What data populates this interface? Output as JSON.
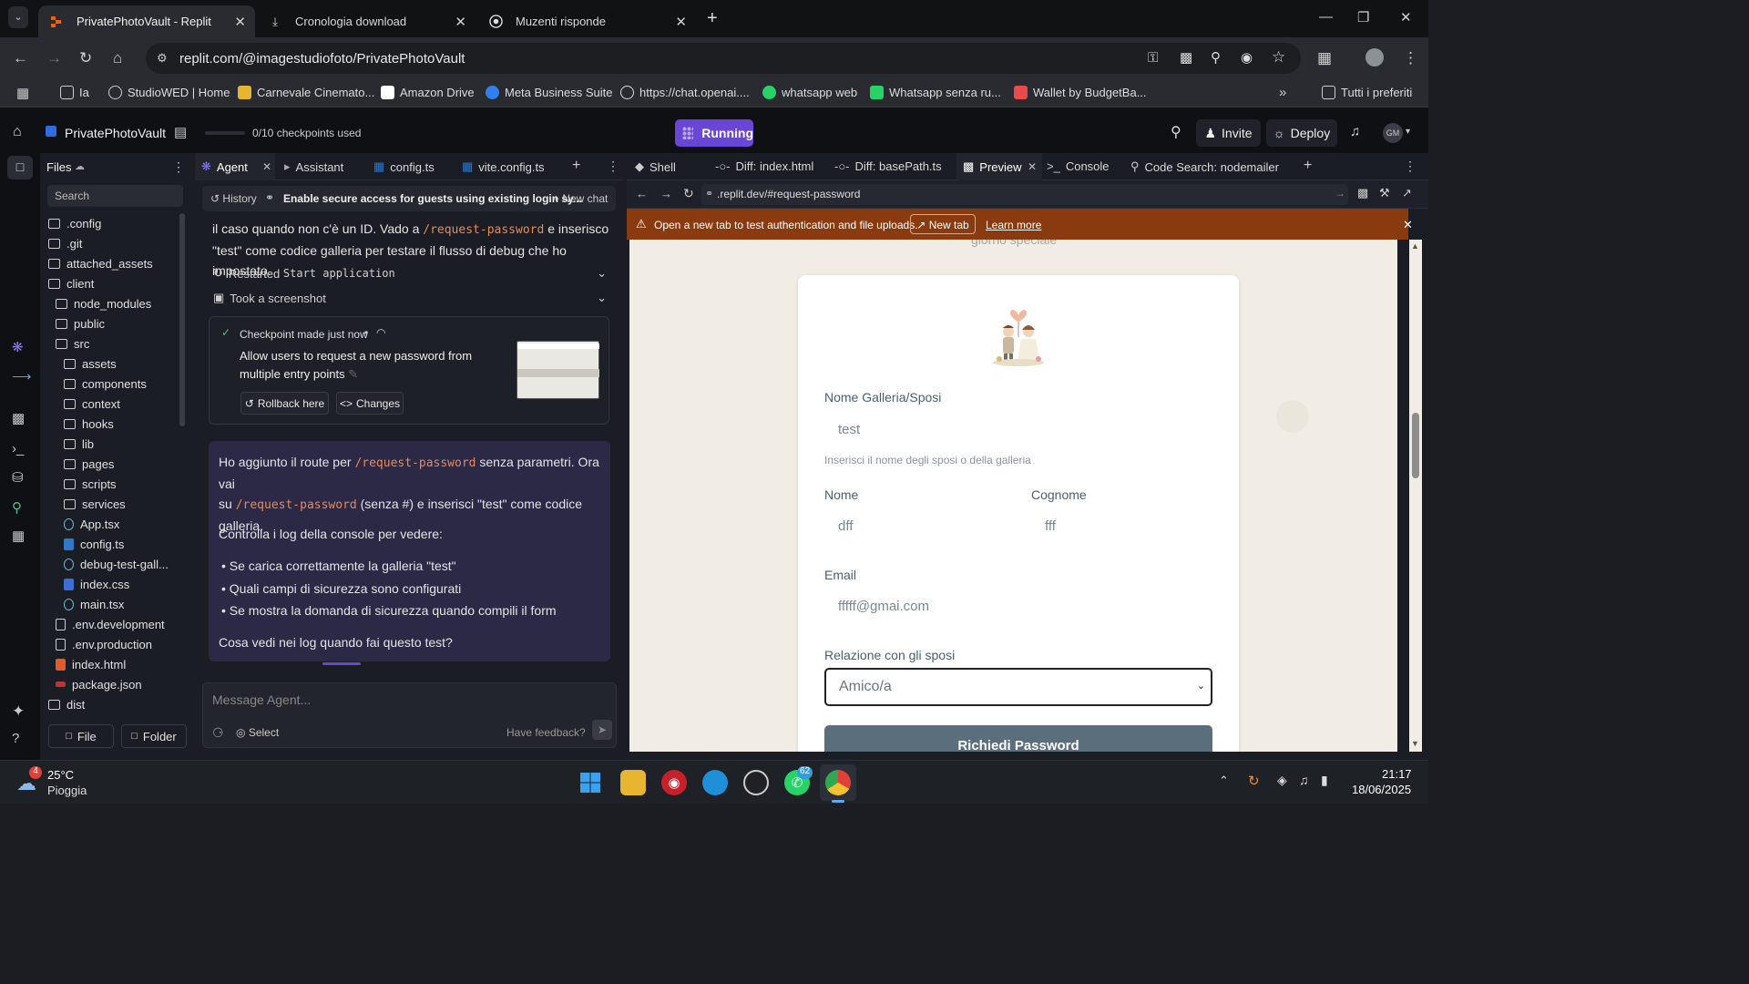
{
  "browser": {
    "tabs": [
      {
        "title": "PrivatePhotoVault - Replit",
        "active": true
      },
      {
        "title": "Cronologia download",
        "active": false
      },
      {
        "title": "Muzenti risponde",
        "active": false
      }
    ],
    "url": "replit.com/@imagestudiofoto/PrivatePhotoVault",
    "bookmarks": [
      "Ia",
      "StudioWED | Home",
      "Carnevale Cinemato...",
      "Amazon Drive",
      "Meta Business Suite",
      "https://chat.openai....",
      "whatsapp web",
      "Whatsapp senza ru...",
      "Wallet by BudgetBa..."
    ],
    "bookmarks_all": "Tutti i preferiti",
    "profile_initials": ""
  },
  "replit": {
    "project_name": "PrivatePhotoVault",
    "checkpoints": "0/10 checkpoints used",
    "run_label": "Running",
    "invite_label": "Invite",
    "deploy_label": "Deploy",
    "user_initials": "GM"
  },
  "files": {
    "title": "Files",
    "search_placeholder": "Search",
    "items": [
      {
        "name": ".config",
        "type": "folder",
        "depth": 0
      },
      {
        "name": ".git",
        "type": "folder",
        "depth": 0
      },
      {
        "name": "attached_assets",
        "type": "folder",
        "depth": 0
      },
      {
        "name": "client",
        "type": "folder",
        "depth": 0
      },
      {
        "name": "node_modules",
        "type": "folder",
        "depth": 1
      },
      {
        "name": "public",
        "type": "folder",
        "depth": 1
      },
      {
        "name": "src",
        "type": "folder",
        "depth": 1
      },
      {
        "name": "assets",
        "type": "folder",
        "depth": 2
      },
      {
        "name": "components",
        "type": "folder",
        "depth": 2
      },
      {
        "name": "context",
        "type": "folder",
        "depth": 2
      },
      {
        "name": "hooks",
        "type": "folder",
        "depth": 2
      },
      {
        "name": "lib",
        "type": "folder",
        "depth": 2
      },
      {
        "name": "pages",
        "type": "folder",
        "depth": 2
      },
      {
        "name": "scripts",
        "type": "folder",
        "depth": 2
      },
      {
        "name": "services",
        "type": "folder",
        "depth": 2
      },
      {
        "name": "App.tsx",
        "type": "react",
        "depth": 2
      },
      {
        "name": "config.ts",
        "type": "ts",
        "depth": 2
      },
      {
        "name": "debug-test-gall...",
        "type": "react",
        "depth": 2
      },
      {
        "name": "index.css",
        "type": "css",
        "depth": 2
      },
      {
        "name": "main.tsx",
        "type": "react",
        "depth": 2
      },
      {
        "name": ".env.development",
        "type": "file",
        "depth": 1
      },
      {
        "name": ".env.production",
        "type": "file",
        "depth": 1
      },
      {
        "name": "index.html",
        "type": "html",
        "depth": 1
      },
      {
        "name": "package.json",
        "type": "json",
        "depth": 1
      },
      {
        "name": "dist",
        "type": "folder",
        "depth": 0
      }
    ],
    "new_file_label": "File",
    "new_folder_label": "Folder"
  },
  "agent": {
    "tabs": [
      "Agent",
      "Assistant",
      "config.ts",
      "vite.config.ts"
    ],
    "history_label": "History",
    "thread_title": "Enable secure access for guests using existing login sy...",
    "new_chat_label": "New chat",
    "prev_text_1": "il caso quando non c'è un ID. Vado a",
    "prev_code": "/request-password",
    "prev_text_2": "e inserisco",
    "prev_text_3": "\"test\" come codice galleria per testare il flusso di debug che ho impostato.",
    "restarted_label": "Restarted",
    "restarted_code": "Start application",
    "screenshot_label": "Took a screenshot",
    "checkpoint": {
      "header": "Checkpoint made just now",
      "message_line1": "Allow users to request a new password from",
      "message_line2": "multiple entry points",
      "rollback_label": "Rollback here",
      "changes_label": "Changes"
    },
    "message": {
      "line1_a": "Ho aggiunto il route per",
      "line1_code": "/request-password",
      "line1_b": "senza parametri. Ora vai",
      "line2_a": "su",
      "line2_code": "/request-password",
      "line2_b": "(senza #) e inserisci \"test\" come codice",
      "line3": "galleria.",
      "para2": "Controlla i log della console per vedere:",
      "bullets": [
        "Se carica correttamente la galleria \"test\"",
        "Quali campi di sicurezza sono configurati",
        "Se mostra la domanda di sicurezza quando compili il form"
      ],
      "question": "Cosa vedi nei log quando fai questo test?"
    },
    "input_placeholder": "Message Agent...",
    "select_label": "Select",
    "feedback_label": "Have feedback?"
  },
  "preview": {
    "tabs": [
      "Shell",
      "Diff: index.html",
      "Diff: basePath.ts",
      "Preview",
      "Console",
      "Code Search: nodemailer"
    ],
    "url": ".replit.dev/#request-password",
    "warning_text": "Open a new tab to test authentication and file uploads.",
    "new_tab_label": "New tab",
    "learn_more_label": "Learn more",
    "cut_text": "giorno speciale",
    "form": {
      "gallery_label": "Nome Galleria/Sposi",
      "gallery_value": "test",
      "gallery_hint": "Inserisci il nome degli sposi o della galleria",
      "first_name_label": "Nome",
      "first_name_value": "dff",
      "last_name_label": "Cognome",
      "last_name_value": "fff",
      "email_label": "Email",
      "email_value": "fffff@gmai.com",
      "relation_label": "Relazione con gli sposi",
      "relation_value": "Amico/a",
      "submit_label": "Richiedi Password"
    }
  },
  "taskbar": {
    "weather_temp": "25°C",
    "weather_desc": "Pioggia",
    "weather_badge": "4",
    "whatsapp_badge": "62",
    "time": "21:17",
    "date": "18/06/2025"
  },
  "colors": {
    "accent": "#6a46d6",
    "warning_bar": "#8a3a0f",
    "code_orange": "#e88a5a",
    "message_bg": "#2b2945"
  }
}
